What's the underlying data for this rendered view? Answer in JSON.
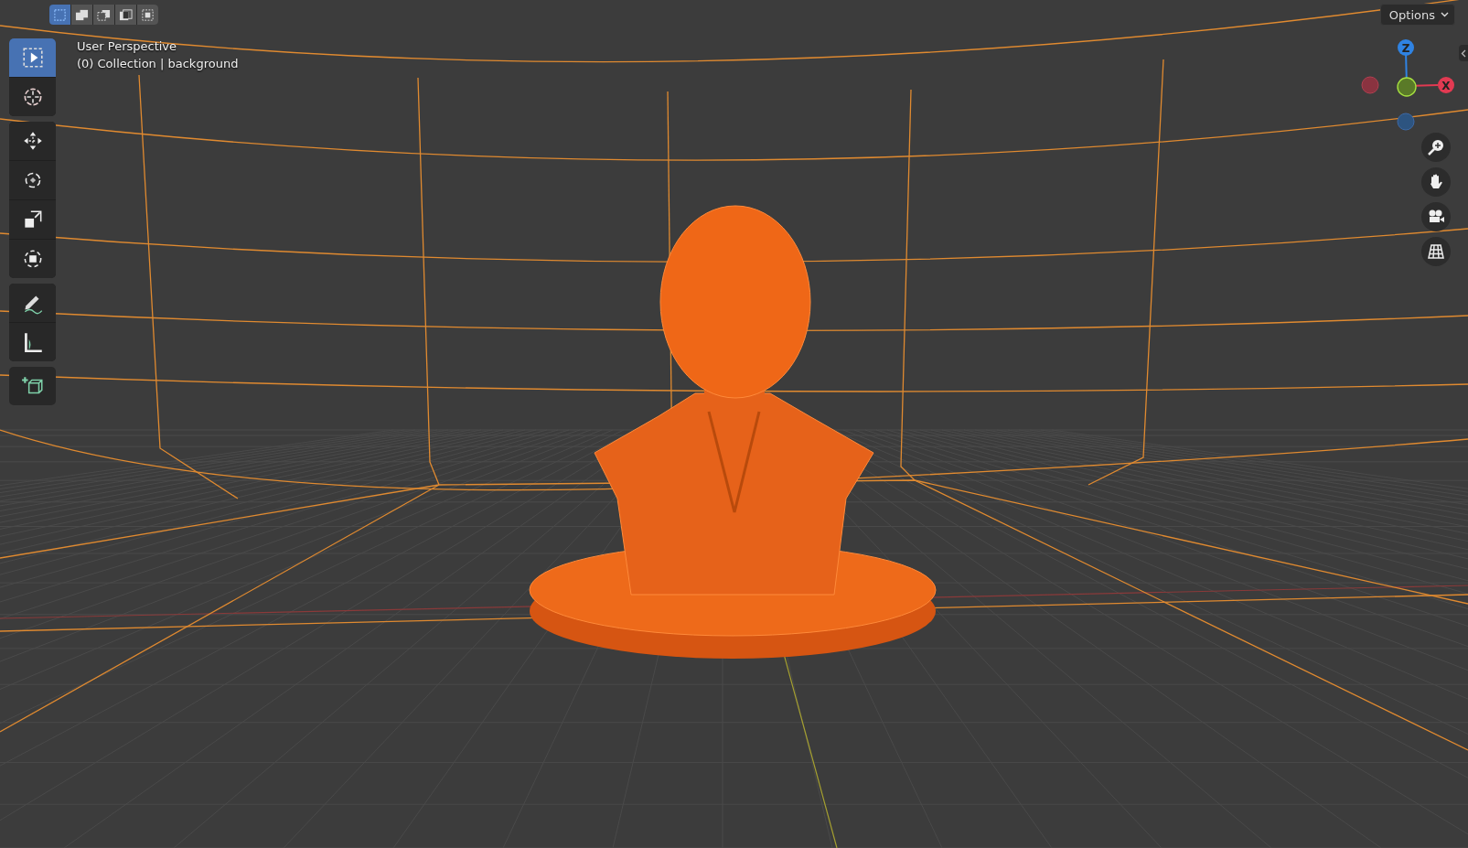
{
  "header": {
    "select_modes": [
      {
        "kind": "new",
        "selected": true
      },
      {
        "kind": "extend",
        "selected": false
      },
      {
        "kind": "subtract",
        "selected": false
      },
      {
        "kind": "invert",
        "selected": false
      },
      {
        "kind": "intersect",
        "selected": false
      }
    ],
    "options": {
      "label": "Options"
    }
  },
  "viewport": {
    "view_name": "User Perspective",
    "collection_info": "(0) Collection | background"
  },
  "toolbar": {
    "groups": [
      [
        {
          "kind": "select",
          "selected": true
        },
        {
          "kind": "cursor",
          "selected": false
        }
      ],
      [
        {
          "kind": "move",
          "selected": false
        },
        {
          "kind": "rotate",
          "selected": false
        },
        {
          "kind": "scale",
          "selected": false
        },
        {
          "kind": "transform",
          "selected": false
        }
      ],
      [
        {
          "kind": "annotate",
          "selected": false
        },
        {
          "kind": "measure",
          "selected": false
        }
      ],
      [
        {
          "kind": "add-cube",
          "selected": false
        }
      ]
    ]
  },
  "gizmo": {
    "axes": [
      {
        "label": "Z",
        "color": "#2f83e3"
      },
      {
        "label": "X",
        "color": "#e23a52"
      }
    ]
  }
}
